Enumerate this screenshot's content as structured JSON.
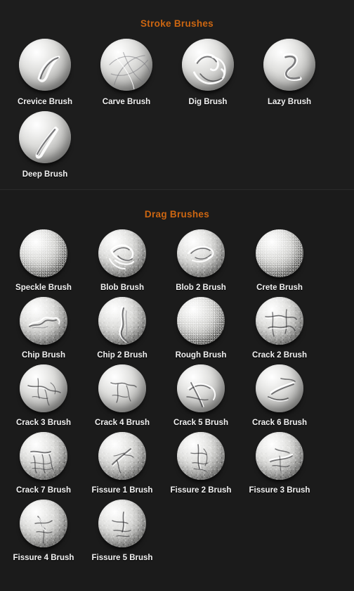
{
  "theme": {
    "background": "#1c1c1c",
    "section_divider": "#2a2a2a",
    "heading_color": "#cc6611",
    "label_color": "#f2f2f2"
  },
  "sections": [
    {
      "id": "stroke-brushes",
      "title": "Stroke Brushes",
      "columns": 4,
      "items": [
        {
          "label": "Crevice Brush",
          "thumb": "sphere-crevice"
        },
        {
          "label": "Carve Brush",
          "thumb": "sphere-carve"
        },
        {
          "label": "Dig Brush",
          "thumb": "sphere-dig"
        },
        {
          "label": "Lazy Brush",
          "thumb": "sphere-lazy"
        },
        {
          "label": "Deep Brush",
          "thumb": "sphere-deep"
        }
      ]
    },
    {
      "id": "drag-brushes",
      "title": "Drag Brushes",
      "columns": 4,
      "items": [
        {
          "label": "Speckle Brush",
          "thumb": "sphere-speckle"
        },
        {
          "label": "Blob Brush",
          "thumb": "sphere-blob"
        },
        {
          "label": "Blob 2 Brush",
          "thumb": "sphere-blob2"
        },
        {
          "label": "Crete Brush",
          "thumb": "sphere-crete"
        },
        {
          "label": "Chip Brush",
          "thumb": "sphere-chip"
        },
        {
          "label": "Chip 2 Brush",
          "thumb": "sphere-chip2"
        },
        {
          "label": "Rough Brush",
          "thumb": "sphere-rough"
        },
        {
          "label": "Crack 2 Brush",
          "thumb": "sphere-crack2"
        },
        {
          "label": "Crack 3 Brush",
          "thumb": "sphere-crack3"
        },
        {
          "label": "Crack 4 Brush",
          "thumb": "sphere-crack4"
        },
        {
          "label": "Crack 5 Brush",
          "thumb": "sphere-crack5"
        },
        {
          "label": "Crack 6 Brush",
          "thumb": "sphere-crack6"
        },
        {
          "label": "Crack 7 Brush",
          "thumb": "sphere-crack7"
        },
        {
          "label": "Fissure 1 Brush",
          "thumb": "sphere-fissure1"
        },
        {
          "label": "Fissure 2 Brush",
          "thumb": "sphere-fissure2"
        },
        {
          "label": "Fissure 3 Brush",
          "thumb": "sphere-fissure3"
        },
        {
          "label": "Fissure 4 Brush",
          "thumb": "sphere-fissure4"
        },
        {
          "label": "Fissure 5 Brush",
          "thumb": "sphere-fissure5"
        }
      ]
    }
  ]
}
